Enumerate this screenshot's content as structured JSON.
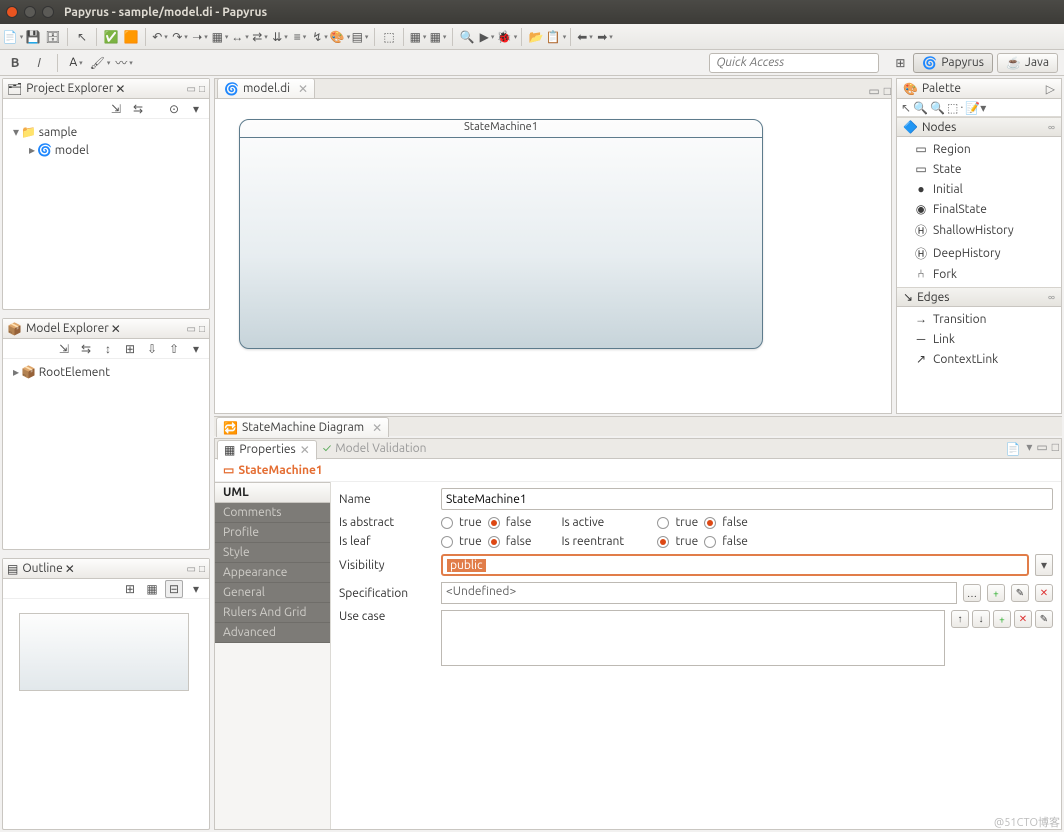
{
  "window": {
    "title": "Papyrus - sample/model.di - Papyrus"
  },
  "quick_access_placeholder": "Quick Access",
  "perspectives": {
    "papyrus": "Papyrus",
    "java": "Java"
  },
  "project_explorer": {
    "title": "Project Explorer",
    "root": "sample",
    "child": "model"
  },
  "model_explorer": {
    "title": "Model Explorer",
    "root": "RootElement"
  },
  "outline": {
    "title": "Outline"
  },
  "editor": {
    "tab": "model.di",
    "diagram_tab": "StateMachine Diagram",
    "sm_title": "StateMachine1"
  },
  "palette": {
    "title": "Palette",
    "nodes_title": "Nodes",
    "edges_title": "Edges",
    "nodes": [
      "Region",
      "State",
      "Initial",
      "FinalState",
      "ShallowHistory",
      "DeepHistory",
      "Fork"
    ],
    "edges": [
      "Transition",
      "Link",
      "ContextLink"
    ]
  },
  "props": {
    "tab_properties": "Properties",
    "tab_validation": "Model Validation",
    "header": "StateMachine1",
    "cat_uml": "UML",
    "cat_comments": "Comments",
    "cat_profile": "Profile",
    "cat_style": "Style",
    "cat_appearance": "Appearance",
    "cat_general": "General",
    "cat_rulers": "Rulers And Grid",
    "cat_advanced": "Advanced",
    "lbl_name": "Name",
    "val_name": "StateMachine1",
    "lbl_isabstract": "Is abstract",
    "lbl_isleaf": "Is leaf",
    "lbl_isactive": "Is active",
    "lbl_isreentrant": "Is reentrant",
    "lbl_visibility": "Visibility",
    "val_visibility": "public",
    "lbl_specification": "Specification",
    "val_specification": "<Undefined>",
    "lbl_usecase": "Use case",
    "opt_true": "true",
    "opt_false": "false"
  },
  "watermark": "@51CTO博客"
}
